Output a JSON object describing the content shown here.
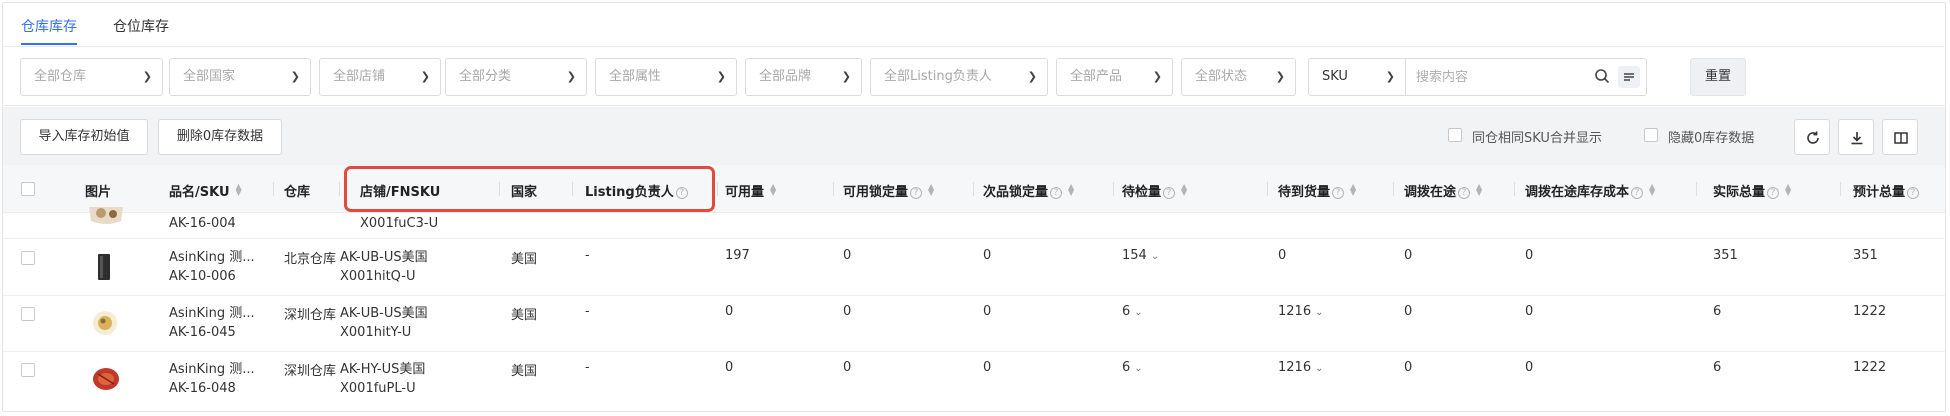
{
  "tabs": [
    {
      "label": "仓库库存",
      "active": true
    },
    {
      "label": "仓位库存",
      "active": false
    }
  ],
  "filters": {
    "warehouse": "全部仓库",
    "country": "全部国家",
    "store": "全部店铺",
    "category": "全部分类",
    "attribute": "全部属性",
    "brand": "全部品牌",
    "listing_owner": "全部Listing负责人",
    "product": "全部产品",
    "status": "全部状态",
    "sku_type": "SKU",
    "search_placeholder": "搜索内容",
    "reset_label": "重置"
  },
  "actions": {
    "import_label": "导入库存初始值",
    "delete_label": "删除0库存数据",
    "merge_label": "同仓相同SKU合并显示",
    "hide_zero_label": "隐藏0库存数据"
  },
  "columns": {
    "image": "图片",
    "name_sku": "品名/SKU",
    "warehouse": "仓库",
    "store_fnsku": "店铺/FNSKU",
    "country": "国家",
    "listing_owner": "Listing负责人",
    "available": "可用量",
    "available_locked": "可用锁定量",
    "defective_locked": "次品锁定量",
    "pending_inspection": "待检量",
    "pending_arrival": "待到货量",
    "transfer_in_transit": "调拨在途",
    "transfer_cost": "调拨在途库存成本",
    "actual_total": "实际总量",
    "forecast_total": "预计总量"
  },
  "rows": [
    {
      "name": "",
      "sku": "AK-16-004",
      "warehouse": "",
      "store": "",
      "fnsku": "X001fuC3-U",
      "country": "",
      "owner": "",
      "available": "",
      "available_locked": "",
      "defective_locked": "",
      "pending_inspection": "",
      "pending_arrival": "",
      "transfer": "",
      "transfer_cost": "",
      "actual_total": "",
      "forecast_total": "",
      "thumb_color": "#b89a6e",
      "partial": true
    },
    {
      "name": "AsinKing 测...",
      "sku": "AK-10-006",
      "warehouse": "北京仓库",
      "store": "AK-UB-US美国",
      "fnsku": "X001hitQ-U",
      "country": "美国",
      "owner": "-",
      "available": "197",
      "available_locked": "0",
      "defective_locked": "0",
      "pending_inspection": "154",
      "pending_arrival": "0",
      "transfer": "0",
      "transfer_cost": "0",
      "actual_total": "351",
      "forecast_total": "351",
      "thumb_color": "#3a3a3a",
      "inspection_arrow": true,
      "arrival_arrow": false
    },
    {
      "name": "AsinKing 测...",
      "sku": "AK-16-045",
      "warehouse": "深圳仓库",
      "store": "AK-UB-US美国",
      "fnsku": "X001hitY-U",
      "country": "美国",
      "owner": "-",
      "available": "0",
      "available_locked": "0",
      "defective_locked": "0",
      "pending_inspection": "6",
      "pending_arrival": "1216",
      "transfer": "0",
      "transfer_cost": "0",
      "actual_total": "6",
      "forecast_total": "1222",
      "thumb_color": "#d9b25a",
      "inspection_arrow": true,
      "arrival_arrow": true
    },
    {
      "name": "AsinKing 测...",
      "sku": "AK-16-048",
      "warehouse": "深圳仓库",
      "store": "AK-HY-US美国",
      "fnsku": "X001fuPL-U",
      "country": "美国",
      "owner": "-",
      "available": "0",
      "available_locked": "0",
      "defective_locked": "0",
      "pending_inspection": "6",
      "pending_arrival": "1216",
      "transfer": "0",
      "transfer_cost": "0",
      "actual_total": "6",
      "forecast_total": "1222",
      "thumb_color": "#c0392b",
      "inspection_arrow": true,
      "arrival_arrow": true
    }
  ],
  "icons": {
    "search": "search-icon",
    "list": "list-icon",
    "refresh": "refresh-icon",
    "download": "download-icon",
    "columns": "columns-icon",
    "help": "help-circle-icon",
    "sort": "sort-icon",
    "expand": "chevron-down-icon"
  },
  "colors": {
    "accent": "#3370ff",
    "highlight": "#e34a3b"
  }
}
